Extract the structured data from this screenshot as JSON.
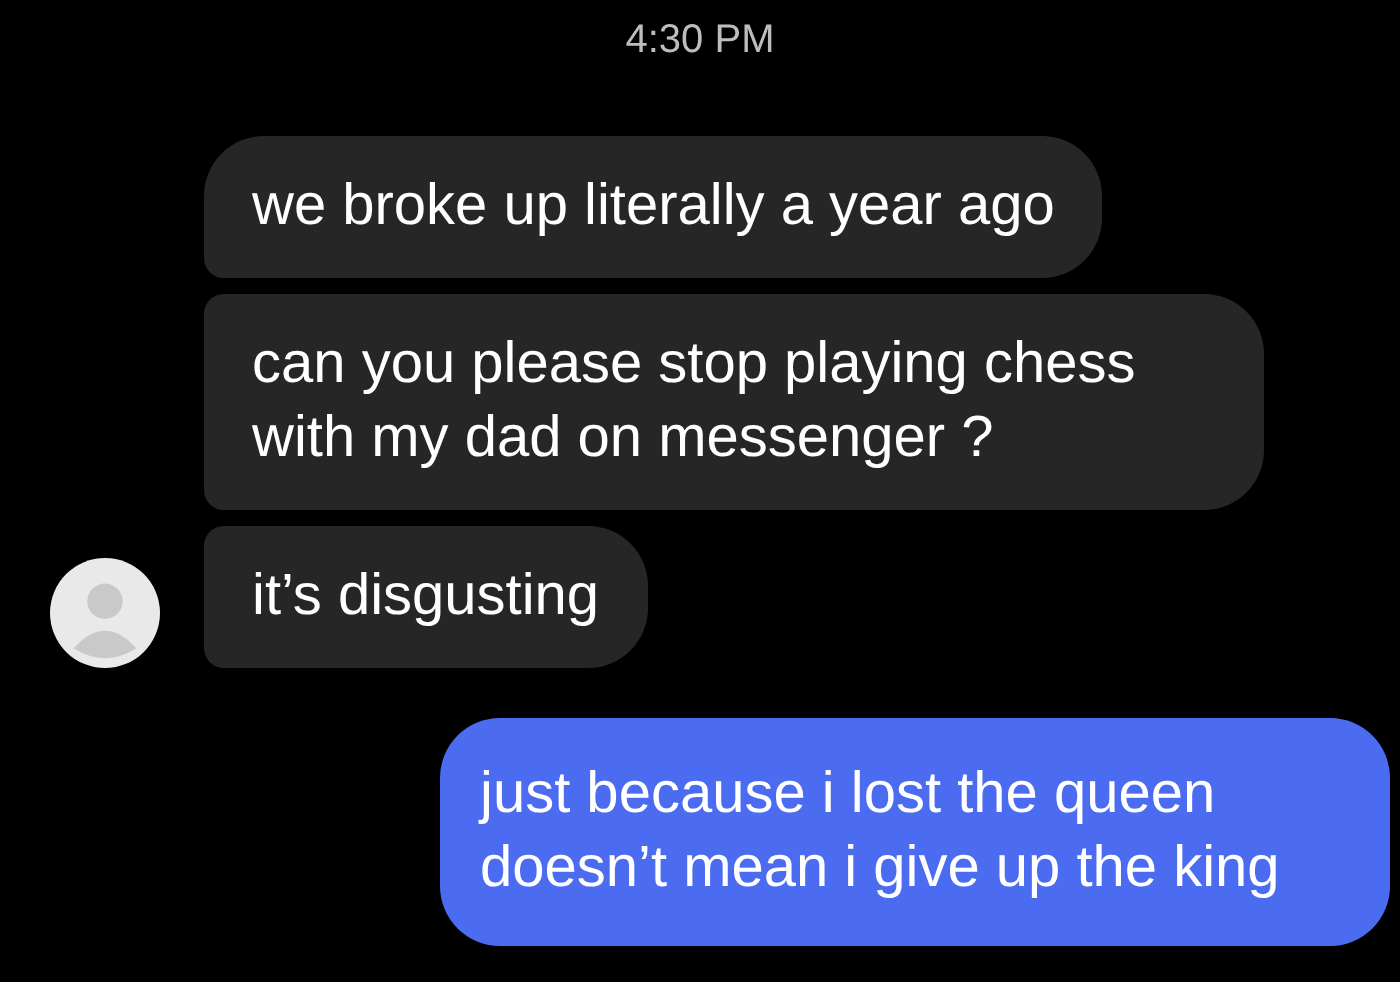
{
  "timestamp": "4:30 PM",
  "messages": [
    {
      "kind": "incoming",
      "text": "we broke up literally a year ago",
      "avatar": false
    },
    {
      "kind": "incoming",
      "text": "can you please stop playing chess with my dad on messenger ?",
      "avatar": false
    },
    {
      "kind": "incoming",
      "text": "it’s disgusting",
      "avatar": true
    },
    {
      "kind": "outgoing",
      "text": "just because i lost the queen doesn’t mean i give up the king"
    }
  ]
}
